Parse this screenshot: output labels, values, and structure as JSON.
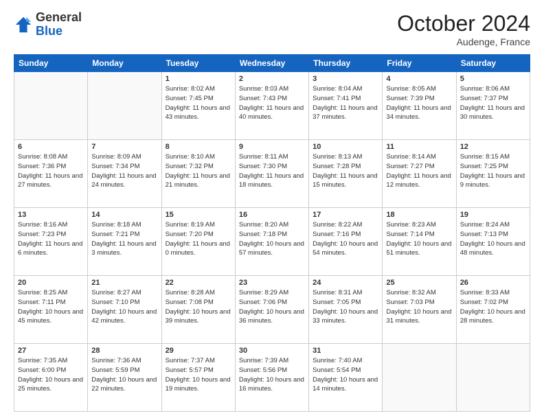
{
  "header": {
    "logo_general": "General",
    "logo_blue": "Blue",
    "month": "October 2024",
    "location": "Audenge, France"
  },
  "weekdays": [
    "Sunday",
    "Monday",
    "Tuesday",
    "Wednesday",
    "Thursday",
    "Friday",
    "Saturday"
  ],
  "weeks": [
    [
      {
        "day": "",
        "info": ""
      },
      {
        "day": "",
        "info": ""
      },
      {
        "day": "1",
        "info": "Sunrise: 8:02 AM\nSunset: 7:45 PM\nDaylight: 11 hours and 43 minutes."
      },
      {
        "day": "2",
        "info": "Sunrise: 8:03 AM\nSunset: 7:43 PM\nDaylight: 11 hours and 40 minutes."
      },
      {
        "day": "3",
        "info": "Sunrise: 8:04 AM\nSunset: 7:41 PM\nDaylight: 11 hours and 37 minutes."
      },
      {
        "day": "4",
        "info": "Sunrise: 8:05 AM\nSunset: 7:39 PM\nDaylight: 11 hours and 34 minutes."
      },
      {
        "day": "5",
        "info": "Sunrise: 8:06 AM\nSunset: 7:37 PM\nDaylight: 11 hours and 30 minutes."
      }
    ],
    [
      {
        "day": "6",
        "info": "Sunrise: 8:08 AM\nSunset: 7:36 PM\nDaylight: 11 hours and 27 minutes."
      },
      {
        "day": "7",
        "info": "Sunrise: 8:09 AM\nSunset: 7:34 PM\nDaylight: 11 hours and 24 minutes."
      },
      {
        "day": "8",
        "info": "Sunrise: 8:10 AM\nSunset: 7:32 PM\nDaylight: 11 hours and 21 minutes."
      },
      {
        "day": "9",
        "info": "Sunrise: 8:11 AM\nSunset: 7:30 PM\nDaylight: 11 hours and 18 minutes."
      },
      {
        "day": "10",
        "info": "Sunrise: 8:13 AM\nSunset: 7:28 PM\nDaylight: 11 hours and 15 minutes."
      },
      {
        "day": "11",
        "info": "Sunrise: 8:14 AM\nSunset: 7:27 PM\nDaylight: 11 hours and 12 minutes."
      },
      {
        "day": "12",
        "info": "Sunrise: 8:15 AM\nSunset: 7:25 PM\nDaylight: 11 hours and 9 minutes."
      }
    ],
    [
      {
        "day": "13",
        "info": "Sunrise: 8:16 AM\nSunset: 7:23 PM\nDaylight: 11 hours and 6 minutes."
      },
      {
        "day": "14",
        "info": "Sunrise: 8:18 AM\nSunset: 7:21 PM\nDaylight: 11 hours and 3 minutes."
      },
      {
        "day": "15",
        "info": "Sunrise: 8:19 AM\nSunset: 7:20 PM\nDaylight: 11 hours and 0 minutes."
      },
      {
        "day": "16",
        "info": "Sunrise: 8:20 AM\nSunset: 7:18 PM\nDaylight: 10 hours and 57 minutes."
      },
      {
        "day": "17",
        "info": "Sunrise: 8:22 AM\nSunset: 7:16 PM\nDaylight: 10 hours and 54 minutes."
      },
      {
        "day": "18",
        "info": "Sunrise: 8:23 AM\nSunset: 7:14 PM\nDaylight: 10 hours and 51 minutes."
      },
      {
        "day": "19",
        "info": "Sunrise: 8:24 AM\nSunset: 7:13 PM\nDaylight: 10 hours and 48 minutes."
      }
    ],
    [
      {
        "day": "20",
        "info": "Sunrise: 8:25 AM\nSunset: 7:11 PM\nDaylight: 10 hours and 45 minutes."
      },
      {
        "day": "21",
        "info": "Sunrise: 8:27 AM\nSunset: 7:10 PM\nDaylight: 10 hours and 42 minutes."
      },
      {
        "day": "22",
        "info": "Sunrise: 8:28 AM\nSunset: 7:08 PM\nDaylight: 10 hours and 39 minutes."
      },
      {
        "day": "23",
        "info": "Sunrise: 8:29 AM\nSunset: 7:06 PM\nDaylight: 10 hours and 36 minutes."
      },
      {
        "day": "24",
        "info": "Sunrise: 8:31 AM\nSunset: 7:05 PM\nDaylight: 10 hours and 33 minutes."
      },
      {
        "day": "25",
        "info": "Sunrise: 8:32 AM\nSunset: 7:03 PM\nDaylight: 10 hours and 31 minutes."
      },
      {
        "day": "26",
        "info": "Sunrise: 8:33 AM\nSunset: 7:02 PM\nDaylight: 10 hours and 28 minutes."
      }
    ],
    [
      {
        "day": "27",
        "info": "Sunrise: 7:35 AM\nSunset: 6:00 PM\nDaylight: 10 hours and 25 minutes."
      },
      {
        "day": "28",
        "info": "Sunrise: 7:36 AM\nSunset: 5:59 PM\nDaylight: 10 hours and 22 minutes."
      },
      {
        "day": "29",
        "info": "Sunrise: 7:37 AM\nSunset: 5:57 PM\nDaylight: 10 hours and 19 minutes."
      },
      {
        "day": "30",
        "info": "Sunrise: 7:39 AM\nSunset: 5:56 PM\nDaylight: 10 hours and 16 minutes."
      },
      {
        "day": "31",
        "info": "Sunrise: 7:40 AM\nSunset: 5:54 PM\nDaylight: 10 hours and 14 minutes."
      },
      {
        "day": "",
        "info": ""
      },
      {
        "day": "",
        "info": ""
      }
    ]
  ]
}
